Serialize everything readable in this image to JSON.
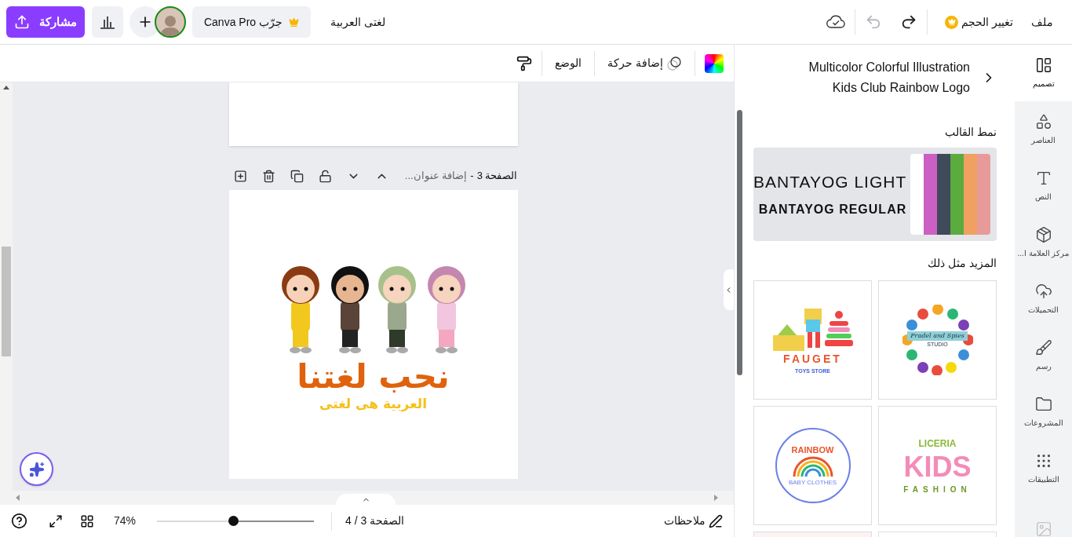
{
  "top_bar": {
    "share": "مشاركة",
    "try_pro": "جرّب Canva Pro",
    "design_title": "لغتى العربية",
    "undo": {
      "disabled": true
    },
    "redo": {
      "disabled": false
    },
    "resize": "تغيير الحجم",
    "file_menu": "ملف"
  },
  "toolbar": {
    "animate": "إضافة حركة",
    "position": "الوضع"
  },
  "canvas": {
    "page_header": {
      "page": "الصفحة 3",
      "separator": "-",
      "title_placeholder": "إضافة عنوان..."
    },
    "design": {
      "headline": "نحب لغتنا",
      "subtitle": "العربية هى لغتى"
    }
  },
  "bottom_bar": {
    "zoom": {
      "level": 0.51,
      "reading": "74%"
    },
    "page_count": "الصفحة 3 / 4",
    "notes": "ملاحظات"
  },
  "panel": {
    "title": "Multicolor Colorful Illustration Kids Club Rainbow Logo",
    "style_heading": "نمط القالب",
    "fonts": [
      {
        "text": "BANTAYOG LIGHT",
        "kind": "light"
      },
      {
        "text": "BANTAYOG REGULAR",
        "kind": "bold"
      }
    ],
    "palette": [
      {
        "color": "#ffffff"
      },
      {
        "color": "#cc5fc4"
      },
      {
        "color": "#3f4a5a"
      },
      {
        "color": "#5bab3f"
      },
      {
        "color": "#f0a060"
      },
      {
        "color": "#e89a9a"
      }
    ],
    "more_heading": "المزيد مثل ذلك",
    "templates": [
      {
        "kind": "dots",
        "texts": [
          "Pradel and Spies",
          "STUDIO"
        ]
      },
      {
        "kind": "toys",
        "texts": [
          "FAUGET",
          "TOYS STORE"
        ]
      },
      {
        "kind": "kids",
        "texts": [
          "LICERIA",
          "KIDS",
          "FASHION"
        ]
      },
      {
        "kind": "rainbow",
        "texts": [
          "RAINBOW",
          "BABY CLOTHES"
        ]
      }
    ]
  },
  "nav": [
    {
      "label": "تصميم",
      "selected": true
    },
    {
      "label": "العناصر",
      "selected": false
    },
    {
      "label": "النص",
      "selected": false
    },
    {
      "label": "مركز العلامة ا...",
      "selected": false
    },
    {
      "label": "التحميلات",
      "selected": false
    },
    {
      "label": "رسم",
      "selected": false
    },
    {
      "label": "المشروعات",
      "selected": false
    },
    {
      "label": "التطبيقات",
      "selected": false
    }
  ]
}
